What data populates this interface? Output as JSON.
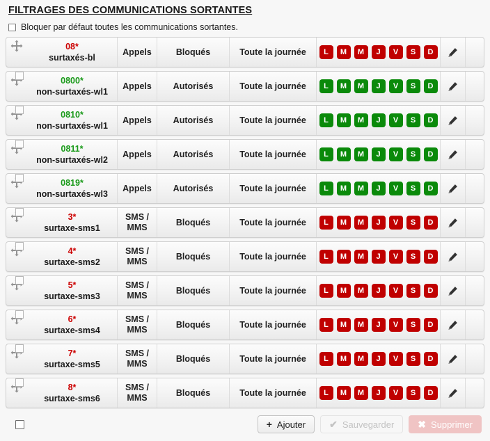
{
  "panel": {
    "title": "FILTRAGES DES COMMUNICATIONS SORTANTES"
  },
  "global_option": {
    "label": "Bloquer par défaut toutes les communications sortantes.",
    "checked": false
  },
  "days": [
    "L",
    "M",
    "M",
    "J",
    "V",
    "S",
    "D"
  ],
  "colors": {
    "blocked_badge": "#c00000",
    "allowed_badge": "#0a8a0a",
    "blocked_number": "#cc0000",
    "allowed_number": "#1a9a1a"
  },
  "rules": [
    {
      "number": "08*",
      "name": "surtaxés-bl",
      "type": "Appels",
      "action": "Bloqués",
      "schedule": "Toute la journée",
      "state": "blocked",
      "handle": "move-icon",
      "edit": "pencil-icon"
    },
    {
      "number": "0800*",
      "name": "non-surtaxés-wl1",
      "type": "Appels",
      "action": "Autorisés",
      "schedule": "Toute la journée",
      "state": "allowed",
      "handle": "move-drag-icon",
      "edit": "pencil-icon"
    },
    {
      "number": "0810*",
      "name": "non-surtaxés-wl1",
      "type": "Appels",
      "action": "Autorisés",
      "schedule": "Toute la journée",
      "state": "allowed",
      "handle": "move-drag-icon",
      "edit": "pencil-icon"
    },
    {
      "number": "0811*",
      "name": "non-surtaxés-wl2",
      "type": "Appels",
      "action": "Autorisés",
      "schedule": "Toute la journée",
      "state": "allowed",
      "handle": "move-drag-icon",
      "edit": "pencil-icon"
    },
    {
      "number": "0819*",
      "name": "non-surtaxés-wl3",
      "type": "Appels",
      "action": "Autorisés",
      "schedule": "Toute la journée",
      "state": "allowed",
      "handle": "move-drag-icon",
      "edit": "pencil-icon"
    },
    {
      "number": "3*",
      "name": "surtaxe-sms1",
      "type": "SMS / MMS",
      "action": "Bloqués",
      "schedule": "Toute la journée",
      "state": "blocked",
      "handle": "move-drag-icon",
      "edit": "pencil-icon"
    },
    {
      "number": "4*",
      "name": "surtaxe-sms2",
      "type": "SMS / MMS",
      "action": "Bloqués",
      "schedule": "Toute la journée",
      "state": "blocked",
      "handle": "move-drag-icon",
      "edit": "pencil-icon"
    },
    {
      "number": "5*",
      "name": "surtaxe-sms3",
      "type": "SMS / MMS",
      "action": "Bloqués",
      "schedule": "Toute la journée",
      "state": "blocked",
      "handle": "move-drag-icon",
      "edit": "pencil-icon"
    },
    {
      "number": "6*",
      "name": "surtaxe-sms4",
      "type": "SMS / MMS",
      "action": "Bloqués",
      "schedule": "Toute la journée",
      "state": "blocked",
      "handle": "move-drag-icon",
      "edit": "pencil-icon"
    },
    {
      "number": "7*",
      "name": "surtaxe-sms5",
      "type": "SMS / MMS",
      "action": "Bloqués",
      "schedule": "Toute la journée",
      "state": "blocked",
      "handle": "move-drag-icon",
      "edit": "pencil-icon"
    },
    {
      "number": "8*",
      "name": "surtaxe-sms6",
      "type": "SMS / MMS",
      "action": "Bloqués",
      "schedule": "Toute la journée",
      "state": "blocked",
      "handle": "move-drag-icon",
      "edit": "pencil-icon"
    }
  ],
  "footer": {
    "select_all_checked": false,
    "buttons": [
      {
        "label": "Ajouter",
        "glyph": "+",
        "icon": "plus-icon",
        "state": "enabled"
      },
      {
        "label": "Sauvegarder",
        "glyph": "✔",
        "icon": "check-icon",
        "state": "disabled"
      },
      {
        "label": "Supprimer",
        "glyph": "✖",
        "icon": "cross-icon",
        "state": "disabled-danger"
      }
    ]
  }
}
